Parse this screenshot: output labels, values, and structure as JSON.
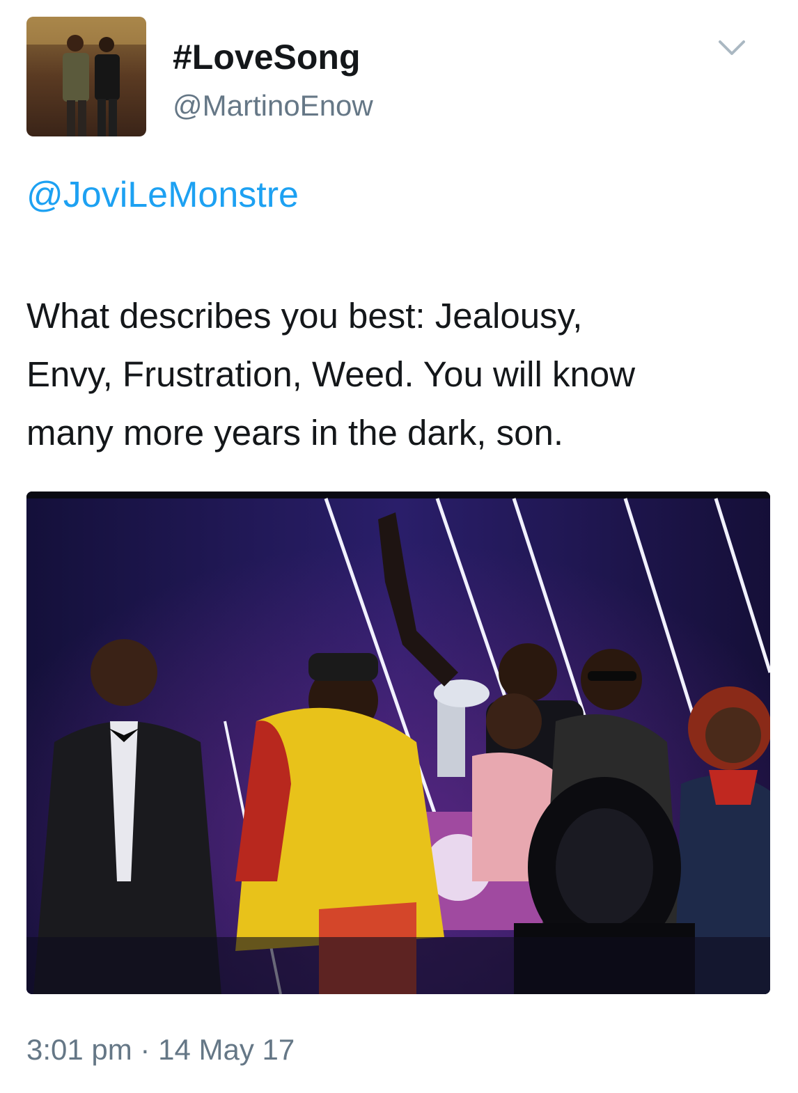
{
  "tweet": {
    "display_name": "#LoveSong",
    "handle": "@MartinoEnow",
    "mention": "@JoviLeMonstre",
    "text": "What describes you best: Jealousy,\nEnvy, Frustration, Weed. You will know\nmany more years in the dark, son.",
    "timestamp": "3:01 pm · 14 May 17"
  },
  "icons": {
    "caret": "chevron-down-icon"
  },
  "colors": {
    "link": "#1da1f2",
    "secondary_text": "#657786",
    "primary_text": "#14171a"
  }
}
